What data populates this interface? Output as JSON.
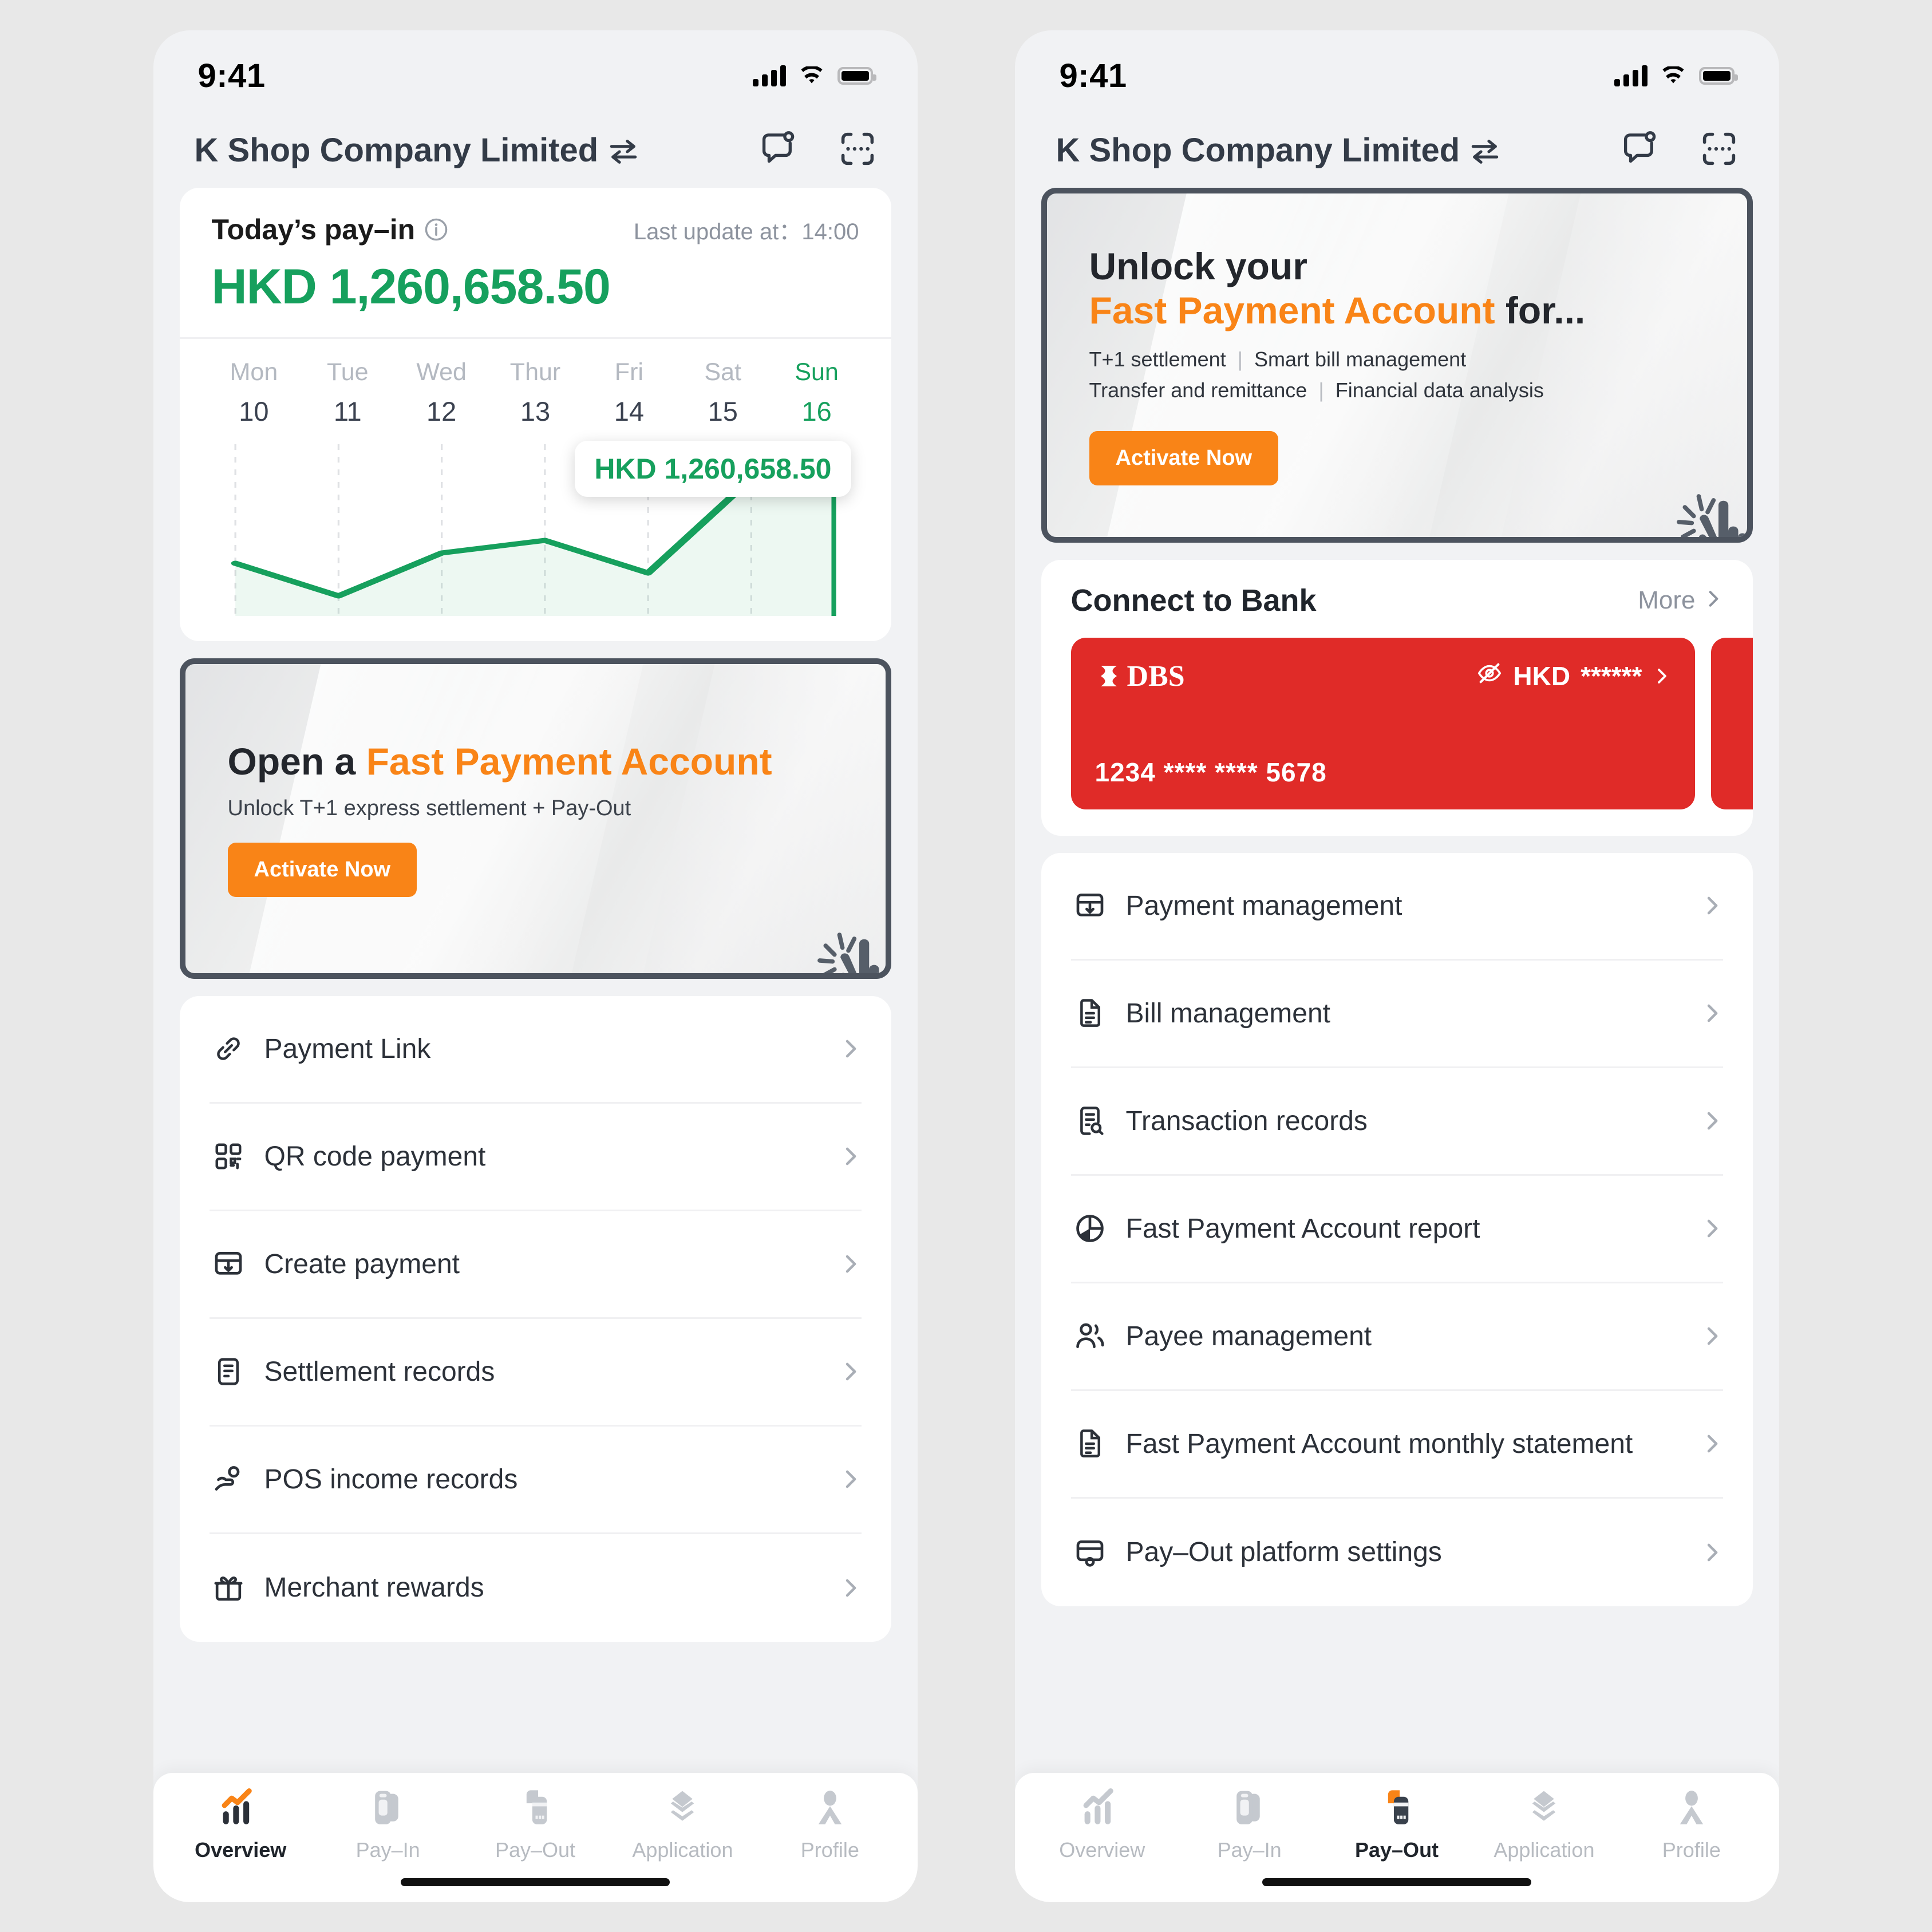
{
  "colors": {
    "green": "#16a05d",
    "orange": "#f98417",
    "dbs_red": "#e02b28",
    "dark": "#4c535e",
    "text": "#2c3139"
  },
  "status_bar": {
    "time": "9:41"
  },
  "header": {
    "company": "K Shop Company Limited",
    "swap_icon": "swap-arrows-icon",
    "chat_icon": "chat-bubble-notification-icon",
    "scan_icon": "scan-frame-icon"
  },
  "left_screen": {
    "payin": {
      "label": "Today’s pay–in",
      "info_icon": "info-circle-icon",
      "last_update": "Last update at：14:00",
      "amount": "HKD 1,260,658.50"
    },
    "chart_data": {
      "type": "line",
      "title": "Today’s pay-in",
      "categories": [
        "Mon",
        "Tue",
        "Wed",
        "Thur",
        "Fri",
        "Sat",
        "Sun"
      ],
      "dates": [
        "10",
        "11",
        "12",
        "13",
        "14",
        "15",
        "16"
      ],
      "highlight_index": 6,
      "values": [
        620000,
        180000,
        760000,
        880000,
        520000,
        1180000,
        1260658.5
      ],
      "ylim": [
        0,
        1400000
      ],
      "xlabel": "",
      "ylabel": "",
      "grid": true,
      "legend": "none",
      "annotation": "HKD 1,260,658.50",
      "series_color": "#16a05d",
      "currency": "HKD"
    },
    "promo": {
      "title_plain": "Open a ",
      "title_accent": "Fast Payment Account",
      "subtitle": "Unlock T+1 express settlement + Pay-Out",
      "button": "Activate Now",
      "cursor_icon": "tap-hand-icon"
    },
    "menu": [
      {
        "icon": "link-icon",
        "label": "Payment Link",
        "chevron": "chevron-right-icon"
      },
      {
        "icon": "qr-code-icon",
        "label": "QR code payment",
        "chevron": "chevron-right-icon"
      },
      {
        "icon": "create-payment-icon",
        "label": "Create payment",
        "chevron": "chevron-right-icon"
      },
      {
        "icon": "document-lines-icon",
        "label": "Settlement records",
        "chevron": "chevron-right-icon"
      },
      {
        "icon": "hand-coin-icon",
        "label": "POS income records",
        "chevron": "chevron-right-icon"
      },
      {
        "icon": "gift-icon",
        "label": "Merchant rewards",
        "chevron": "chevron-right-icon"
      }
    ],
    "tabs": [
      {
        "icon": "bar-chart-trend-icon",
        "label": "Overview",
        "active": true
      },
      {
        "icon": "pay-in-icon",
        "label": "Pay–In",
        "active": false
      },
      {
        "icon": "pay-out-icon",
        "label": "Pay–Out",
        "active": false
      },
      {
        "icon": "layers-icon",
        "label": "Application",
        "active": false
      },
      {
        "icon": "person-icon",
        "label": "Profile",
        "active": false
      }
    ]
  },
  "right_screen": {
    "promo": {
      "line1": "Unlock your",
      "line2_accent": "Fast Payment Account",
      "line2_plain": " for...",
      "features": [
        [
          "T+1 settlement",
          "Smart bill management"
        ],
        [
          "Transfer and remittance",
          "Financial data analysis"
        ]
      ],
      "button": "Activate Now",
      "cursor_icon": "tap-hand-icon"
    },
    "bank": {
      "title": "Connect to Bank",
      "more": "More",
      "more_chevron": "chevron-right-icon",
      "cards": [
        {
          "logo_text": "DBS",
          "logo_icon": "dbs-hourglass-icon",
          "eye_icon": "eye-off-icon",
          "currency": "HKD",
          "balance_masked": "******",
          "chevron": "chevron-right-icon",
          "number": "1234 **** **** 5678"
        }
      ]
    },
    "menu": [
      {
        "icon": "create-payment-icon",
        "label": "Payment management",
        "chevron": "chevron-right-icon"
      },
      {
        "icon": "document-icon",
        "label": "Bill management",
        "chevron": "chevron-right-icon"
      },
      {
        "icon": "document-search-icon",
        "label": "Transaction records",
        "chevron": "chevron-right-icon"
      },
      {
        "icon": "pie-chart-icon",
        "label": "Fast Payment Account report",
        "chevron": "chevron-right-icon"
      },
      {
        "icon": "people-icon",
        "label": "Payee management",
        "chevron": "chevron-right-icon"
      },
      {
        "icon": "document-icon",
        "label": "Fast Payment Account monthly statement",
        "chevron": "chevron-right-icon"
      },
      {
        "icon": "settings-card-icon",
        "label": "Pay–Out platform settings",
        "chevron": "chevron-right-icon"
      }
    ],
    "tabs": [
      {
        "icon": "bar-chart-trend-icon",
        "label": "Overview",
        "active": false
      },
      {
        "icon": "pay-in-icon",
        "label": "Pay–In",
        "active": false
      },
      {
        "icon": "pay-out-icon",
        "label": "Pay–Out",
        "active": true
      },
      {
        "icon": "layers-icon",
        "label": "Application",
        "active": false
      },
      {
        "icon": "person-icon",
        "label": "Profile",
        "active": false
      }
    ]
  }
}
